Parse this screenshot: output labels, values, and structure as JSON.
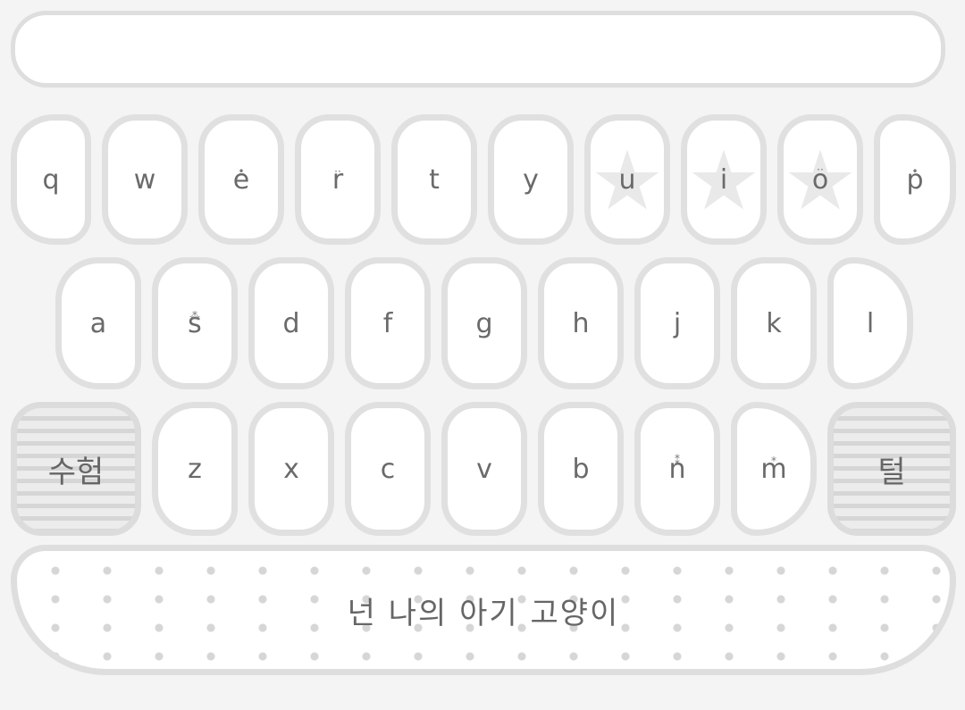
{
  "input": {
    "value": ""
  },
  "rows": {
    "row1": [
      "q",
      "w",
      "e",
      "r",
      "t",
      "y",
      "u",
      "i",
      "o",
      "p"
    ],
    "row2": [
      "a",
      "s",
      "d",
      "f",
      "g",
      "h",
      "j",
      "k",
      "l"
    ],
    "row3": [
      "z",
      "x",
      "c",
      "v",
      "b",
      "n",
      "m"
    ]
  },
  "shift_label": "수험",
  "delete_label": "털",
  "space_label": "넌 나의 아기 고양이",
  "colors": {
    "key_border": "#e0e0e0",
    "key_text": "#6a6a6a",
    "background": "#f4f4f4"
  },
  "icons": {
    "decor": "star-icon"
  }
}
